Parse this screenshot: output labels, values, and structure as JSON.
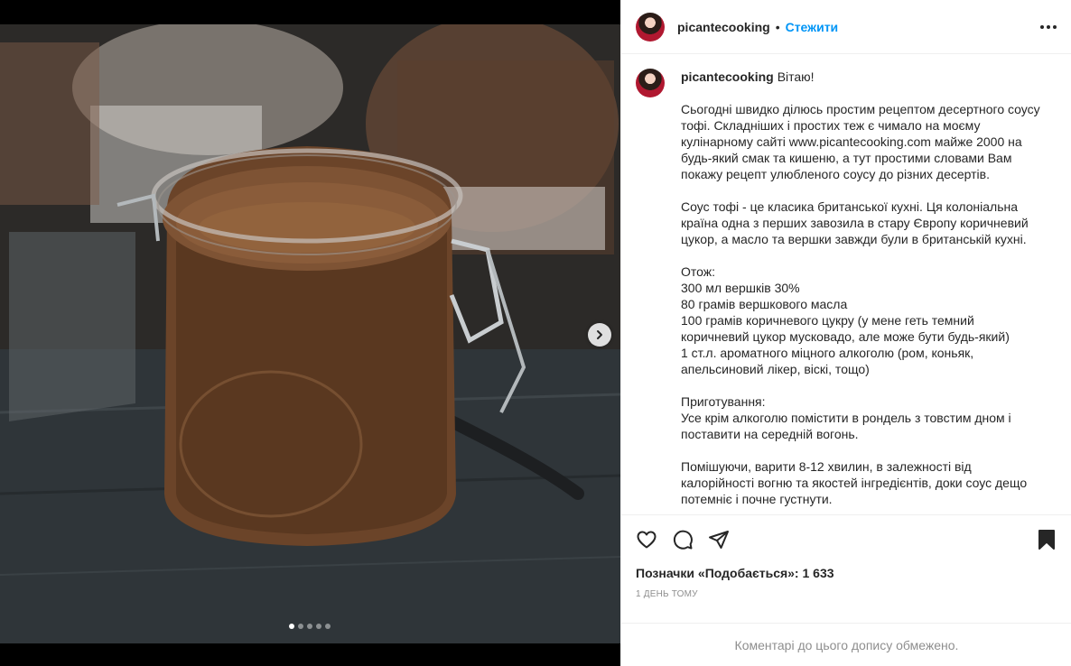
{
  "post": {
    "username": "picantecooking",
    "follow_label": "Стежити",
    "bullet": "•",
    "carousel": {
      "total": 5,
      "active_index": 0
    },
    "caption": {
      "greeting": "Вітаю!",
      "paragraphs": [
        "Сьогодні швидко ділюсь простим рецептом десертного соусу тофі. Складніших і простих теж є чимало на моєму кулінарному сайті www.picantecooking.com майже 2000 на будь-який смак та кишеню, а тут простими словами Вам покажу рецепт улюбленого соусу до різних десертів.",
        "Соус тофі - це класика британської кухні. Ця колоніальна країна одна з перших завозила в стару Європу коричневий цукор, а масло та вершки завжди були в британській кухні.",
        "Отож:\n300 мл вершків 30%\n80 грамів вершкового масла\n100 грамів коричневого цукру (у мене геть темний коричневий цукор мусковадо, але може бути будь-який)\n1 ст.л. ароматного міцного алкоголю (ром, коньяк, апельсиновий лікер, віскі, тощо)",
        "Приготування:\nУсе крім алкоголю помістити в рондель з товстим дном і поставити на середній вогонь.",
        "Помішуючи, варити 8-12 хвилин, в залежності від калорійності вогню та якостей інгредієнтів, доки соус дещо потемніє і почне густнути."
      ]
    },
    "likes_label": "Позначки «Подобається»:",
    "likes_count": "1 633",
    "time": "1 день тому",
    "comments_limited": "Коментарі до цього допису обмежено."
  },
  "icons": {
    "like": "heart-icon",
    "comment": "comment-icon",
    "share": "paper-plane-icon",
    "save": "bookmark-icon",
    "more": "more-horizontal-icon",
    "next": "chevron-right-icon"
  },
  "colors": {
    "link": "#0095f6",
    "text": "#262626",
    "muted": "#8e8e8e",
    "border": "#efefef"
  }
}
